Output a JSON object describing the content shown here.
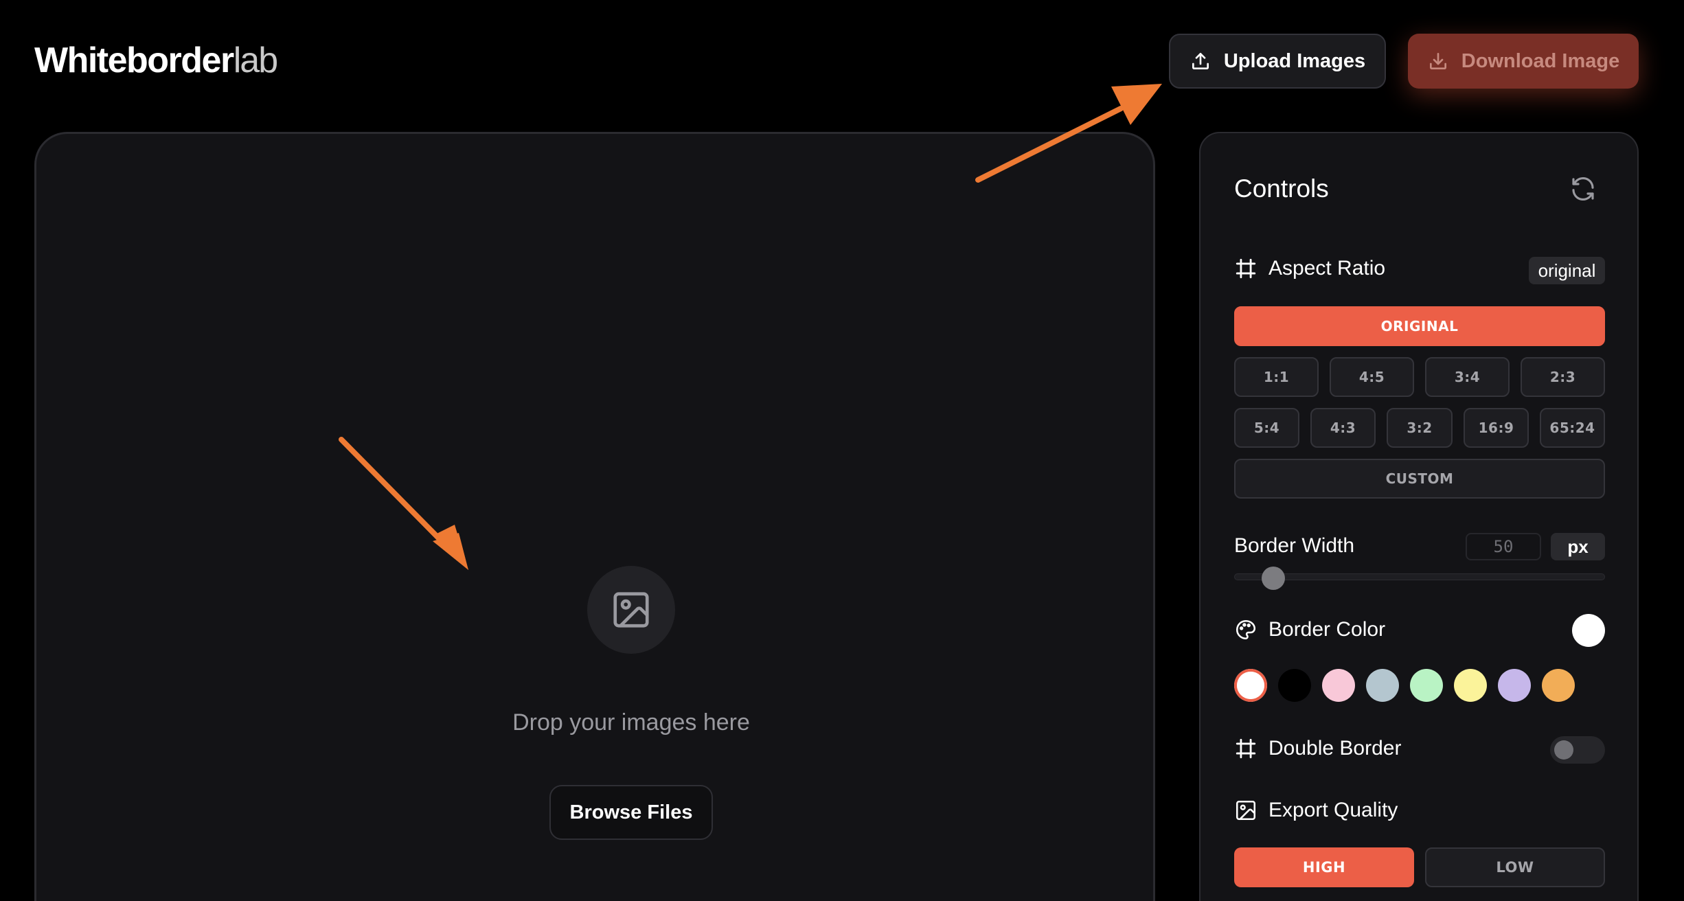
{
  "header": {
    "logo_bold": "Whiteborder",
    "logo_light": "lab",
    "upload_label": "Upload Images",
    "download_label": "Download Image"
  },
  "dropzone": {
    "icon": "image-icon",
    "prompt": "Drop your images here",
    "browse_label": "Browse Files"
  },
  "controls": {
    "title": "Controls",
    "aspect_ratio": {
      "label": "Aspect Ratio",
      "current": "original",
      "options_row1": [
        "ORIGINAL"
      ],
      "options_row2": [
        "1:1",
        "4:5",
        "3:4",
        "2:3"
      ],
      "options_row3": [
        "5:4",
        "4:3",
        "3:2",
        "16:9",
        "65:24"
      ],
      "custom_label": "CUSTOM",
      "selected": "ORIGINAL"
    },
    "border_width": {
      "label": "Border Width",
      "value": "50",
      "unit": "px",
      "slider_fraction": 0.08
    },
    "border_color": {
      "label": "Border Color",
      "current": "#ffffff",
      "swatches": [
        "#ffffff",
        "#000000",
        "#f8c8d8",
        "#b4c6cf",
        "#b9f3c4",
        "#fbf39a",
        "#c6b7ea",
        "#f2ad57"
      ],
      "selected_index": 0
    },
    "double_border": {
      "label": "Double Border",
      "enabled": false
    },
    "export_quality": {
      "label": "Export Quality",
      "options": [
        "HIGH",
        "LOW"
      ],
      "selected": "HIGH"
    }
  },
  "colors": {
    "accent": "#ec5f47",
    "annotation_arrow": "#ee7a33",
    "panel_bg": "#131316"
  }
}
